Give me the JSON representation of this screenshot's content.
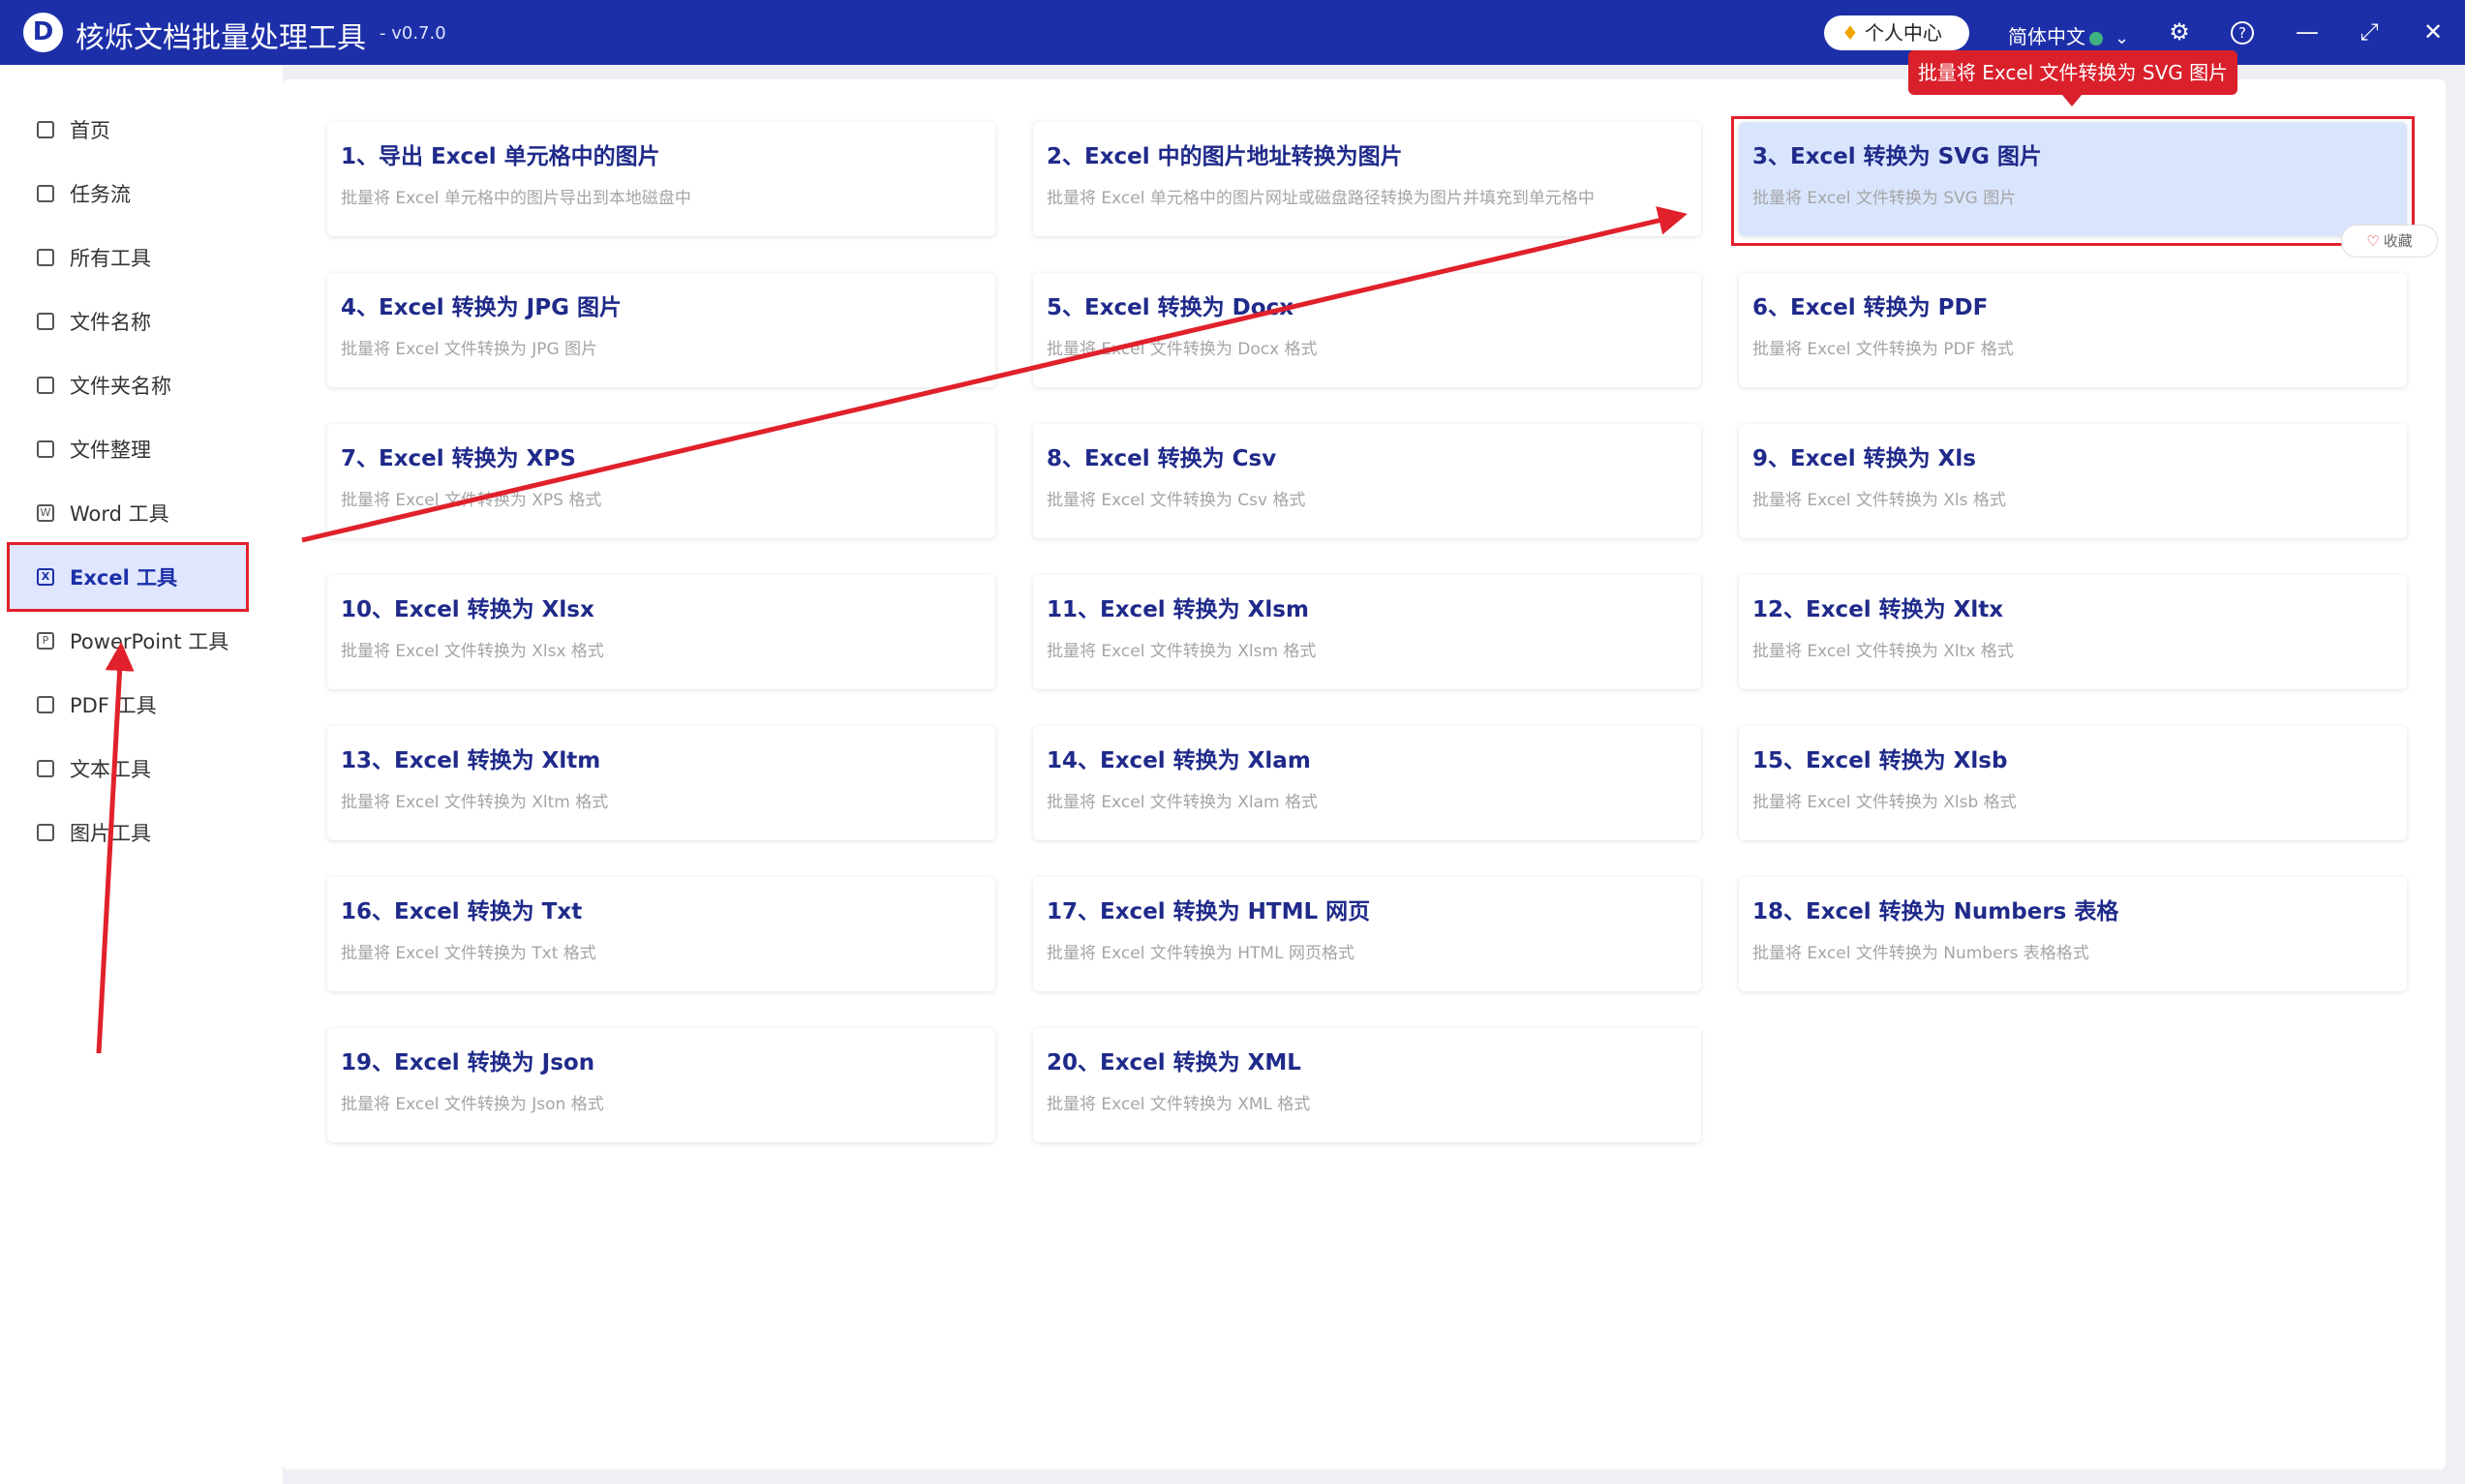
{
  "app": {
    "logo_letter": "D",
    "title": "核烁文档批量处理工具",
    "version": "- v0.7.0",
    "vip_label": "个人中心",
    "language": "简体中文"
  },
  "sidebar": {
    "items": [
      {
        "label": "首页",
        "icon": "home-icon"
      },
      {
        "label": "任务流",
        "icon": "workflow-icon"
      },
      {
        "label": "所有工具",
        "icon": "monitor-icon"
      },
      {
        "label": "文件名称",
        "icon": "file-icon"
      },
      {
        "label": "文件夹名称",
        "icon": "folder-icon"
      },
      {
        "label": "文件整理",
        "icon": "organize-icon"
      },
      {
        "label": "Word 工具",
        "icon": "word-icon"
      },
      {
        "label": "Excel 工具",
        "icon": "excel-icon",
        "active": true
      },
      {
        "label": "PowerPoint 工具",
        "icon": "ppt-icon"
      },
      {
        "label": "PDF 工具",
        "icon": "pdf-icon"
      },
      {
        "label": "文本工具",
        "icon": "text-icon"
      },
      {
        "label": "图片工具",
        "icon": "image-icon"
      }
    ]
  },
  "tools": [
    {
      "title": "1、导出 Excel 单元格中的图片",
      "desc": "批量将 Excel 单元格中的图片导出到本地磁盘中"
    },
    {
      "title": "2、Excel 中的图片地址转换为图片",
      "desc": "批量将 Excel 单元格中的图片网址或磁盘路径转换为图片并填充到单元格中"
    },
    {
      "title": "3、Excel 转换为 SVG 图片",
      "desc": "批量将 Excel 文件转换为 SVG 图片",
      "selected": true
    },
    {
      "title": "4、Excel 转换为 JPG 图片",
      "desc": "批量将 Excel 文件转换为 JPG 图片"
    },
    {
      "title": "5、Excel 转换为 Docx",
      "desc": "批量将 Excel 文件转换为 Docx 格式"
    },
    {
      "title": "6、Excel 转换为 PDF",
      "desc": "批量将 Excel 文件转换为 PDF 格式"
    },
    {
      "title": "7、Excel 转换为 XPS",
      "desc": "批量将 Excel 文件转换为 XPS 格式"
    },
    {
      "title": "8、Excel 转换为 Csv",
      "desc": "批量将 Excel 文件转换为 Csv 格式"
    },
    {
      "title": "9、Excel 转换为 Xls",
      "desc": "批量将 Excel 文件转换为 Xls 格式"
    },
    {
      "title": "10、Excel 转换为 Xlsx",
      "desc": "批量将 Excel 文件转换为 Xlsx 格式"
    },
    {
      "title": "11、Excel 转换为 Xlsm",
      "desc": "批量将 Excel 文件转换为 Xlsm 格式"
    },
    {
      "title": "12、Excel 转换为 Xltx",
      "desc": "批量将 Excel 文件转换为 Xltx 格式"
    },
    {
      "title": "13、Excel 转换为 Xltm",
      "desc": "批量将 Excel 文件转换为 Xltm 格式"
    },
    {
      "title": "14、Excel 转换为 Xlam",
      "desc": "批量将 Excel 文件转换为 Xlam 格式"
    },
    {
      "title": "15、Excel 转换为 Xlsb",
      "desc": "批量将 Excel 文件转换为 Xlsb 格式"
    },
    {
      "title": "16、Excel 转换为 Txt",
      "desc": "批量将 Excel 文件转换为 Txt 格式"
    },
    {
      "title": "17、Excel 转换为 HTML 网页",
      "desc": "批量将 Excel 文件转换为 HTML 网页格式"
    },
    {
      "title": "18、Excel 转换为 Numbers 表格",
      "desc": "批量将 Excel 文件转换为 Numbers 表格格式"
    },
    {
      "title": "19、Excel 转换为 Json",
      "desc": "批量将 Excel 文件转换为 Json 格式"
    },
    {
      "title": "20、Excel 转换为 XML",
      "desc": "批量将 Excel 文件转换为 XML 格式"
    }
  ],
  "tooltip": "批量将 Excel 文件转换为 SVG 图片",
  "favorite_label": "收藏",
  "colors": {
    "titlebar": "#1d2fa8",
    "accent": "#1f2a8a",
    "annotation_red": "#e0212b",
    "selected_card": "#d9e5fd"
  }
}
